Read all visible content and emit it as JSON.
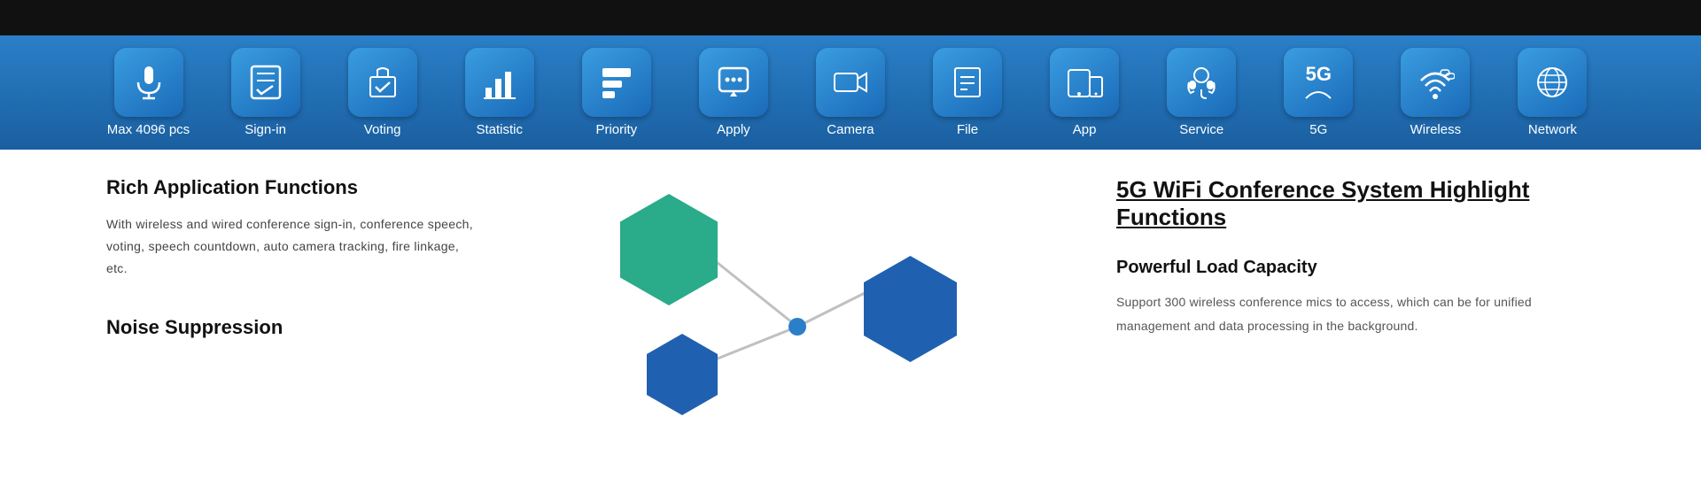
{
  "topBar": {
    "height": 40
  },
  "iconBar": {
    "items": [
      {
        "id": "max4096",
        "label": "Max 4096 pcs",
        "icon": "🎤",
        "unicode": "🎤"
      },
      {
        "id": "signin",
        "label": "Sign-in",
        "icon": "📋",
        "unicode": "✅"
      },
      {
        "id": "voting",
        "label": "Voting",
        "icon": "🗳",
        "unicode": "🗳"
      },
      {
        "id": "statistic",
        "label": "Statistic",
        "icon": "📊",
        "unicode": "📊"
      },
      {
        "id": "priority",
        "label": "Priority",
        "icon": "🗂",
        "unicode": "🗂"
      },
      {
        "id": "apply",
        "label": "Apply",
        "icon": "💬",
        "unicode": "💬"
      },
      {
        "id": "camera",
        "label": "Camera",
        "icon": "📹",
        "unicode": "📹"
      },
      {
        "id": "file",
        "label": "File",
        "icon": "📁",
        "unicode": "📁"
      },
      {
        "id": "app",
        "label": "App",
        "icon": "📱",
        "unicode": "📱"
      },
      {
        "id": "service",
        "label": "Service",
        "icon": "🎧",
        "unicode": "🎧"
      },
      {
        "id": "5g",
        "label": "5G",
        "icon": "5G",
        "unicode": "5G"
      },
      {
        "id": "wireless",
        "label": "Wireless",
        "icon": "📡",
        "unicode": "📡"
      },
      {
        "id": "network",
        "label": "Network",
        "icon": "🌐",
        "unicode": "🌐"
      }
    ]
  },
  "leftSection": {
    "title": "Rich Application Functions",
    "description": "With wireless and wired conference sign-in, conference speech, voting, speech countdown, auto camera tracking, fire linkage, etc.",
    "noiseTitle": "Noise Suppression"
  },
  "rightSection": {
    "mainTitle": "5G WiFi Conference System  Highlight Functions",
    "cardTitle": "Powerful Load Capacity",
    "cardDescription": "Support 300 wireless conference mics to access, which can be  for unified management and data processing in the background."
  }
}
